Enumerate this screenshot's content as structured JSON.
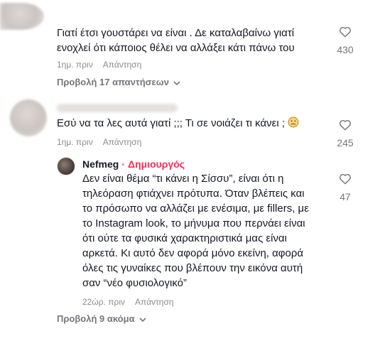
{
  "comments": [
    {
      "text_lines": [
        "Γιατί έτσι γουστάρει να είναι . Δε καταλαβαίνω γιατί",
        "ενοχλεί ότι κάποιος θέλει να αλλάξει κάτι πάνω του"
      ],
      "time": "1ημ. πριν",
      "reply_label": "Απάντηση",
      "likes": "430",
      "view_replies": "Προβολή 17 απαντήσεων"
    },
    {
      "text": "Εσύ να τα λες αυτά γιατί ;;; Τι σε νοιάζει τι κάνει ;",
      "time": "1ημ. πριν",
      "reply_label": "Απάντηση",
      "likes": "245"
    }
  ],
  "reply": {
    "username": "Nefmeg",
    "separator": "·",
    "badge": "Δημιουργός",
    "text_lines": [
      "Δεν είναι θέμα “τι κάνει η Σίσσυ”, είναι ότι η",
      "τηλεόραση φτιάχνει πρότυπα. Όταν βλέπεις και",
      "το πρόσωπο να αλλάζει με ενέσιμα, με fillers, με",
      "το Instagram look, το μήνυμα που περνάει είναι",
      "ότι ούτε τα φυσικά χαρακτηριστικά μας είναι",
      "αρκετά. Κι αυτό δεν αφορά μόνο εκείνη, αφορά",
      "όλες τις γυναίκες που βλέπουν την εικόνα αυτή",
      "σαν “νέο φυσιολογικό”"
    ],
    "time": "22ώρ. πριν",
    "reply_label": "Απάντηση",
    "likes": "47"
  },
  "view_more": "Προβολή 9 ακόμα",
  "colors": {
    "creator": "#fe2c55",
    "muted": "#8a8b91",
    "text": "#161823"
  }
}
